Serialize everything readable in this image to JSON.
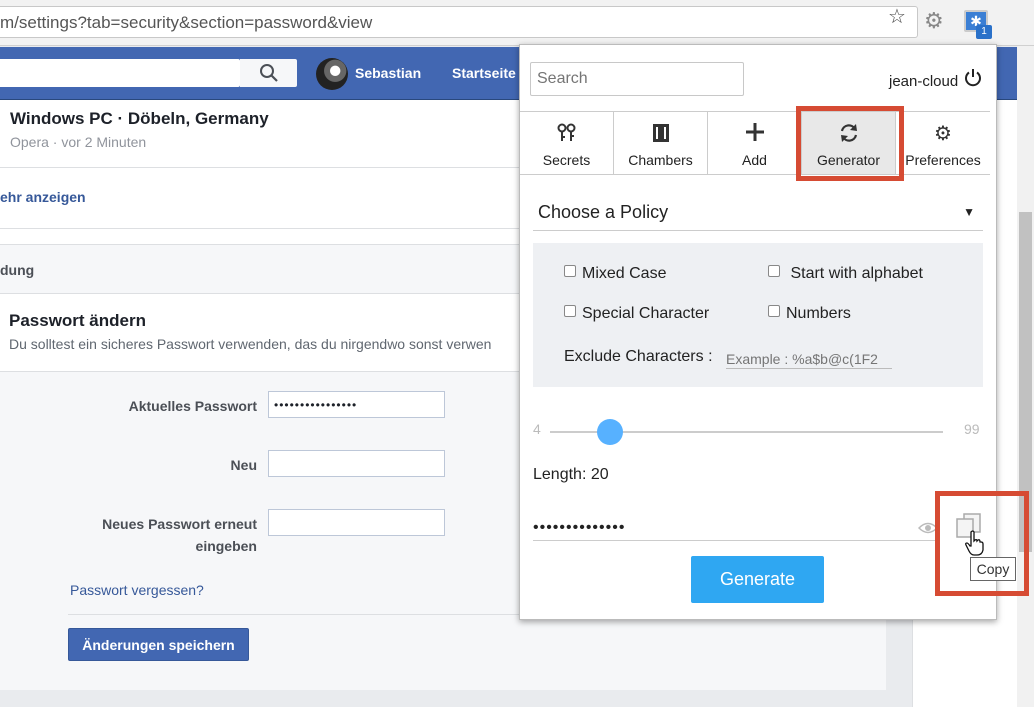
{
  "browser": {
    "url": "m/settings?tab=security&section=password&view",
    "badge_count": "1"
  },
  "fb_header": {
    "user_name": "Sebastian",
    "home_label": "Startseite"
  },
  "session": {
    "title": "Windows PC · Döbeln, Germany",
    "subtitle": "Opera · vor 2 Minuten",
    "more_link": "ehr anzeigen"
  },
  "section": {
    "label": "dung"
  },
  "password_section": {
    "title": "Passwort ändern",
    "description": "Du solltest ein sicheres Passwort verwenden, das du nirgendwo sonst verwen",
    "current_label": "Aktuelles Passwort",
    "current_value": "••••••••••••••••",
    "new_label": "Neu",
    "repeat_label_line1": "Neues Passwort erneut",
    "repeat_label_line2": "eingeben",
    "forgot_link": "Passwort vergessen?",
    "save_button": "Änderungen speichern"
  },
  "popup": {
    "search_placeholder": "Search",
    "username": "jean-cloud",
    "tabs": [
      {
        "label": "Secrets",
        "icon": "keys-icon"
      },
      {
        "label": "Chambers",
        "icon": "chamber-icon"
      },
      {
        "label": "Add",
        "icon": "plus-icon"
      },
      {
        "label": "Generator",
        "icon": "sync-icon",
        "active": true
      },
      {
        "label": "Preferences",
        "icon": "gear-icon"
      }
    ],
    "policy": "Choose a Policy",
    "options": {
      "mixed_case": "Mixed Case",
      "start_alphabet": "Start with alphabet",
      "special_char": "Special Character",
      "numbers": "Numbers"
    },
    "exclude_label": "Exclude Characters :",
    "exclude_placeholder": "Example : %a$b@c(1F2",
    "slider": {
      "min": "4",
      "max": "99",
      "value": 20
    },
    "length_label": "Length: 20",
    "generated_password": "••••••••••••••",
    "generate_button": "Generate",
    "copy_tooltip": "Copy"
  },
  "colors": {
    "fb_blue": "#4267b2",
    "accent": "#2fa7f2",
    "highlight": "#d64b33"
  }
}
